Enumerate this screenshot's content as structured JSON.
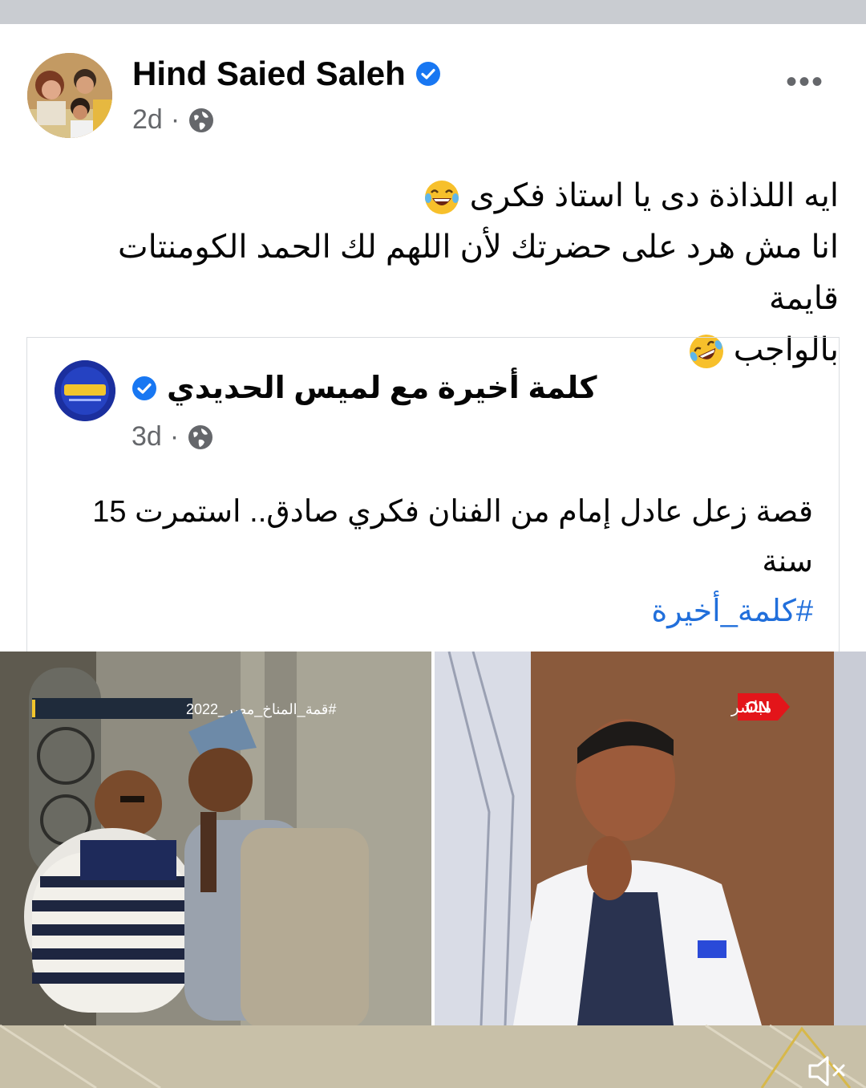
{
  "post": {
    "author": "Hind Saied Saleh",
    "time": "2d",
    "separator": "·",
    "more_label": "•••",
    "text_lines": [
      "ايه اللذاذة دى يا استاذ فكرى",
      "انا مش هرد على حضرتك لأن اللهم لك الحمد الكومنتات قايمة",
      "بالواجب"
    ]
  },
  "shared": {
    "author": "كلمة أخيرة مع لميس الحديدي",
    "time": "3d",
    "separator": "·",
    "text_lines": [
      "قصة زعل عادل إمام من الفنان فكري صادق.. استمرت 15",
      "سنة"
    ],
    "hashtag": "#كلمة_أخيرة"
  },
  "media": {
    "left_overlay": "#قمة_المناخ_مصر_2022",
    "channel_logo": "ON",
    "live_label": "مباشر"
  },
  "colors": {
    "verified": "#1877f2",
    "hashtag": "#216fdb",
    "meta": "#65676b",
    "on_red": "#e3151a"
  },
  "icons": [
    "verified-badge-icon",
    "globe-icon",
    "more-options-icon",
    "laughing-emoji-icon",
    "rofl-emoji-icon",
    "mute-icon"
  ]
}
